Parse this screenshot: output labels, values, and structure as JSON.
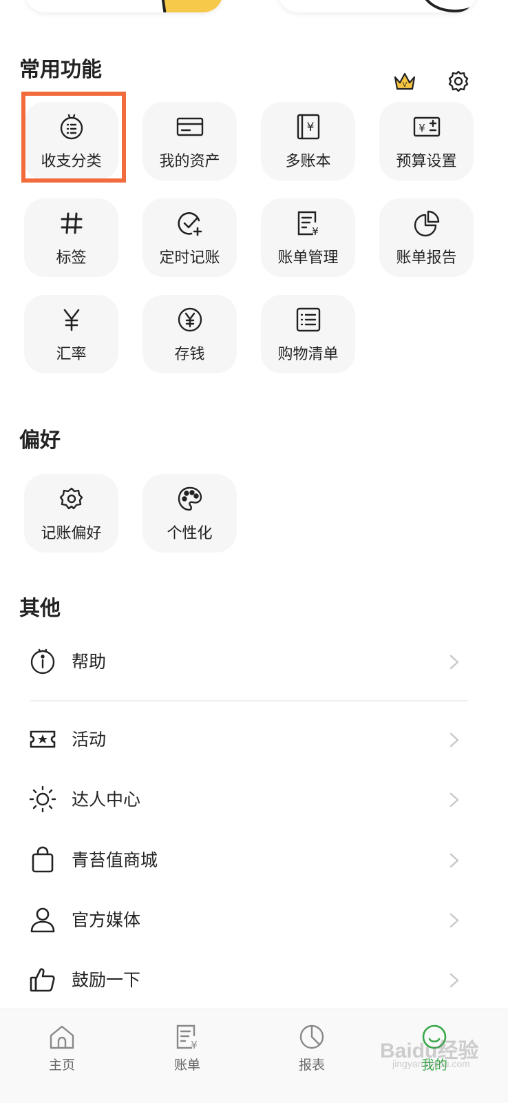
{
  "sections": {
    "common": "常用功能",
    "preferences": "偏好",
    "other": "其他"
  },
  "header_icons": [
    "crown-icon",
    "gear-icon"
  ],
  "common_features": [
    {
      "label": "收支分类",
      "icon": "category-icon"
    },
    {
      "label": "我的资产",
      "icon": "card-icon"
    },
    {
      "label": "多账本",
      "icon": "ledger-book-icon"
    },
    {
      "label": "预算设置",
      "icon": "budget-icon"
    },
    {
      "label": "标签",
      "icon": "hashtag-icon"
    },
    {
      "label": "定时记账",
      "icon": "scheduled-check-icon"
    },
    {
      "label": "账单管理",
      "icon": "bill-icon"
    },
    {
      "label": "账单报告",
      "icon": "pie-report-icon"
    },
    {
      "label": "汇率",
      "icon": "yen-icon"
    },
    {
      "label": "存钱",
      "icon": "yen-coin-icon"
    },
    {
      "label": "购物清单",
      "icon": "checklist-icon"
    }
  ],
  "preferences": [
    {
      "label": "记账偏好",
      "icon": "gear-flower-icon"
    },
    {
      "label": "个性化",
      "icon": "palette-icon"
    }
  ],
  "other_items": [
    {
      "label": "帮助",
      "icon": "info-icon"
    },
    {
      "label": "活动",
      "icon": "ticket-icon"
    },
    {
      "label": "达人中心",
      "icon": "sun-icon"
    },
    {
      "label": "青苔值商城",
      "icon": "shopping-bag-icon"
    },
    {
      "label": "官方媒体",
      "icon": "user-icon"
    },
    {
      "label": "鼓励一下",
      "icon": "thumbs-up-icon"
    }
  ],
  "tabbar": [
    {
      "label": "主页",
      "icon": "home-icon"
    },
    {
      "label": "账单",
      "icon": "bill-tab-icon"
    },
    {
      "label": "报表",
      "icon": "chart-tab-icon"
    },
    {
      "label": "我的",
      "icon": "profile-tab-icon",
      "active": true
    }
  ],
  "watermark": {
    "main": "Baidu经验",
    "sub": "jingyan.baidu.com"
  },
  "colors": {
    "accent_green": "#3aa84a",
    "highlight_orange": "#f26b3c",
    "crown_gold": "#f5c542"
  }
}
